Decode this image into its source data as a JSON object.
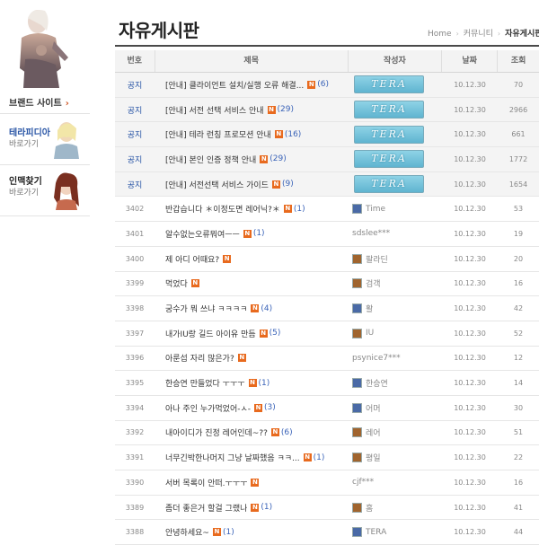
{
  "sidebar": {
    "brand_link": "브랜드 사이트",
    "terapedia": {
      "title": "테라피디아",
      "sub": "바로가기"
    },
    "inmaek": {
      "title": "인맥찾기",
      "sub": "바로가기"
    }
  },
  "header": {
    "title": "자유게시판",
    "breadcrumb": [
      "Home",
      "커뮤니티",
      "자유게시판"
    ]
  },
  "table": {
    "columns": [
      "번호",
      "제목",
      "작성자",
      "날짜",
      "조회"
    ],
    "rows": [
      {
        "no": "공지",
        "title": "[안내] 클라이언트 설치/실행 오류 해결...",
        "comments": "(6)",
        "author": "TERA",
        "author_type": "badge",
        "date": "10.12.30",
        "views": "70"
      },
      {
        "no": "공지",
        "title": "[안내] 서전 선택 서비스 안내",
        "comments": "(29)",
        "author": "TERA",
        "author_type": "badge",
        "date": "10.12.30",
        "views": "2966"
      },
      {
        "no": "공지",
        "title": "[안내] 테라 런칭 프로모션 안내",
        "comments": "(16)",
        "author": "TERA",
        "author_type": "badge",
        "date": "10.12.30",
        "views": "661"
      },
      {
        "no": "공지",
        "title": "[안내] 본인 인증 정책 안내",
        "comments": "(29)",
        "author": "TERA",
        "author_type": "badge",
        "date": "10.12.30",
        "views": "1772"
      },
      {
        "no": "공지",
        "title": "[안내] 서전선택 서비스 가이드",
        "comments": "(9)",
        "author": "TERA",
        "author_type": "badge",
        "date": "10.12.30",
        "views": "1654"
      },
      {
        "no": "3402",
        "title": "반갑습니다 ＊이정도면 레어닉?＊",
        "comments": "(1)",
        "author": "Time",
        "author_type": "blue",
        "date": "10.12.30",
        "views": "53"
      },
      {
        "no": "3401",
        "title": "알수없는오류뭐여ㅡㅡ",
        "comments": "(1)",
        "author": "sdslee***",
        "author_type": "none",
        "date": "10.12.30",
        "views": "19"
      },
      {
        "no": "3400",
        "title": "제 아디 어때요?",
        "comments": "",
        "author": "팔라딘",
        "author_type": "brown",
        "date": "10.12.30",
        "views": "20"
      },
      {
        "no": "3399",
        "title": "먹었다",
        "comments": "",
        "author": "검객",
        "author_type": "brown",
        "date": "10.12.30",
        "views": "16"
      },
      {
        "no": "3398",
        "title": "궁수가 뭐 쓰냐 ㅋㅋㅋㅋ",
        "comments": "(4)",
        "author": "활",
        "author_type": "blue",
        "date": "10.12.30",
        "views": "42"
      },
      {
        "no": "3397",
        "title": "내가IU랑 길드 아이유 만듬",
        "comments": "(5)",
        "author": "IU",
        "author_type": "brown",
        "date": "10.12.30",
        "views": "52"
      },
      {
        "no": "3396",
        "title": "아룬섭 자리 많은가?",
        "comments": "",
        "author": "psynice7***",
        "author_type": "none",
        "date": "10.12.30",
        "views": "12"
      },
      {
        "no": "3395",
        "title": "한승연 만들었다 ㅜㅜㅜ",
        "comments": "(1)",
        "author": "한승연",
        "author_type": "blue",
        "date": "10.12.30",
        "views": "14"
      },
      {
        "no": "3394",
        "title": "아나 주인 누가먹었어-ㅅ-",
        "comments": "(3)",
        "author": "어머",
        "author_type": "blue",
        "date": "10.12.30",
        "views": "30"
      },
      {
        "no": "3392",
        "title": "내아이디가 진정 레어인데~??",
        "comments": "(6)",
        "author": "레어",
        "author_type": "brown",
        "date": "10.12.30",
        "views": "51"
      },
      {
        "no": "3391",
        "title": "너무긴박한나머지 그냥 날짜했음 ㅋㅋ...",
        "comments": "(1)",
        "author": "평일",
        "author_type": "brown",
        "date": "10.12.30",
        "views": "22"
      },
      {
        "no": "3390",
        "title": "서버 목록이 안떠.ㅜㅜㅜ",
        "comments": "",
        "author": "cjf***",
        "author_type": "none",
        "date": "10.12.30",
        "views": "16"
      },
      {
        "no": "3389",
        "title": "좀더 좋은거 할걸 그랬나",
        "comments": "(1)",
        "author": "홈",
        "author_type": "brown",
        "date": "10.12.30",
        "views": "41"
      },
      {
        "no": "3388",
        "title": "안녕하세요~",
        "comments": "(1)",
        "author": "TERA",
        "author_type": "blue",
        "date": "10.12.30",
        "views": "44"
      }
    ]
  },
  "colors": {
    "accent_blue": "#2a56a6",
    "new_badge": "#e86a1e",
    "notice_bg": "#f4f4f4"
  },
  "icons": {
    "new_badge": "N",
    "brand_arrow": "chevron-right-icon"
  }
}
